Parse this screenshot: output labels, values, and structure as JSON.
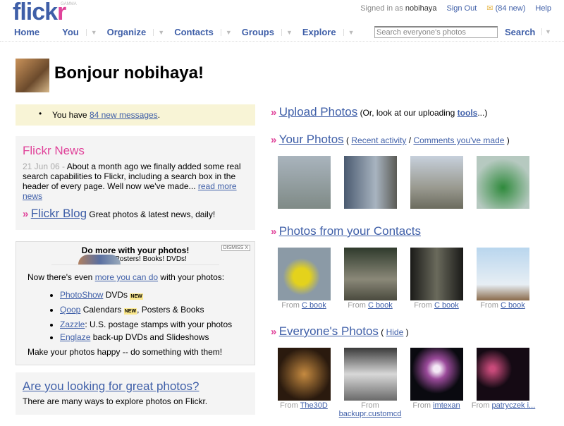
{
  "header": {
    "logo_main": "flick",
    "logo_r": "r",
    "gamma": "GAMMA",
    "signed_in_label": "Signed in as",
    "username": "nobihaya",
    "sign_out": "Sign Out",
    "new_count": "(84 new)",
    "help": "Help",
    "mail_icon": "envelope-icon"
  },
  "nav": [
    {
      "label": "Home"
    },
    {
      "label": "You"
    },
    {
      "label": "Organize"
    },
    {
      "label": "Contacts"
    },
    {
      "label": "Groups"
    },
    {
      "label": "Explore"
    }
  ],
  "search": {
    "placeholder": "Search everyone's photos",
    "button": "Search"
  },
  "greeting": "Bonjour nobihaya!",
  "messages": {
    "pre": "You have",
    "link": "84 new messages",
    "post": "."
  },
  "news": {
    "title": "Flickr News",
    "date": "21 Jun 06 -",
    "body": "About a month ago we finally added some real search capabilities to Flickr, including a search box in the header of every page. Well now we've made...",
    "link": "read more news",
    "blog_link": "Flickr Blog",
    "blog_desc": "Great photos & latest news, daily!"
  },
  "promo": {
    "title": "Do more with your photos!",
    "subtitle": "Posters! Books! DVDs!",
    "dismiss": "DISMISS X",
    "intro_pre": "Now there's even",
    "intro_link": "more you can do",
    "intro_post": "with your photos:",
    "new_badge": "NEW",
    "items": [
      {
        "link": "PhotoShow",
        "text": " DVDs "
      },
      {
        "link": "Qoop",
        "text": " Calendars ",
        "text2": ", Posters & Books"
      },
      {
        "link": "Zazzle",
        "text": ": U.S. postage stamps with your photos"
      },
      {
        "link": "Englaze",
        "text": " back-up DVDs and Slideshows"
      }
    ],
    "footer": "Make your photos happy -- do something with them!"
  },
  "looking": {
    "title": "Are you looking for great photos?",
    "desc": "There are many ways to explore photos on Flickr."
  },
  "upload": {
    "title": "Upload Photos",
    "pre": "(Or, look at our uploading",
    "link": "tools",
    "post": "...)"
  },
  "your_photos": {
    "title": "Your Photos",
    "open": "(",
    "recent": "Recent activity",
    "sep": "/",
    "comments": "Comments you've made",
    "close": ")"
  },
  "contacts": {
    "title": "Photos from your Contacts",
    "from": "From",
    "items": [
      {
        "user": "C book"
      },
      {
        "user": "C book"
      },
      {
        "user": "C book"
      },
      {
        "user": "C book"
      }
    ]
  },
  "everyone": {
    "title": "Everyone's Photos",
    "open": "(",
    "hide": "Hide",
    "close": ")",
    "from": "From",
    "items": [
      {
        "user": "The30D"
      },
      {
        "user": "backupr.customcd"
      },
      {
        "user": "imtexan"
      },
      {
        "user": "patryczek i..."
      }
    ]
  },
  "colors": {
    "link": "#3f5fa8",
    "pink": "#e0439a",
    "message_bg": "#f8f4d6",
    "box_bg": "#f4f4f4"
  }
}
